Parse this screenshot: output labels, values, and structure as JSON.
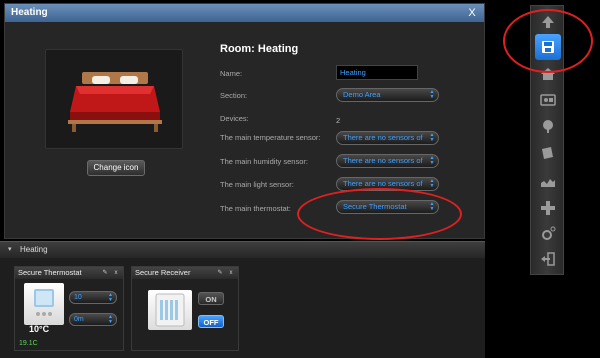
{
  "dialog": {
    "title": "Heating",
    "close_label": "X",
    "room_title": "Room: Heating",
    "change_icon_label": "Change icon",
    "fields": {
      "name_label": "Name:",
      "name_value": "Heating",
      "section_label": "Section:",
      "section_value": "Demo Area",
      "devices_label": "Devices:",
      "devices_value": "2",
      "temp_sensor_label": "The main temperature sensor:",
      "temp_sensor_value": "There are no sensors of",
      "humidity_sensor_label": "The main humidity sensor:",
      "humidity_sensor_value": "There are no sensors of",
      "light_sensor_label": "The main light sensor:",
      "light_sensor_value": "There are no sensors of",
      "thermostat_label": "The main thermostat:",
      "thermostat_value": "Secure Thermostat"
    }
  },
  "group": {
    "label": "Heating",
    "chevron": "▾"
  },
  "widgets": {
    "thermostat": {
      "title": "Secure Thermostat",
      "setpoint": "10",
      "mode": "0m",
      "temperature": "10°C",
      "sub_reading": "19.1C"
    },
    "receiver": {
      "title": "Secure Receiver",
      "on_label": "ON",
      "off_label": "OFF"
    },
    "wrench_icon": "wrench-icon",
    "close_glyph": "x"
  },
  "toolbar": {
    "items": [
      "up-arrow-icon",
      "save-icon",
      "home-icon",
      "scenes-icon",
      "dot-icon",
      "camera-icon",
      "chart-icon",
      "plugins-icon",
      "settings-icon",
      "logout-icon"
    ],
    "active_index": 1
  },
  "colors": {
    "accent": "#3fa0ff",
    "title_bar": "#4a72a4",
    "annotation": "#e02020",
    "green": "#5cd65c"
  }
}
